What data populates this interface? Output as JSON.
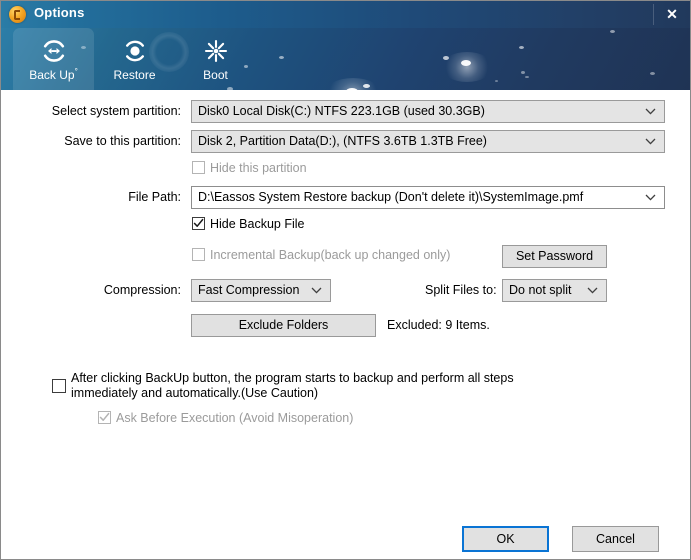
{
  "window": {
    "title": "Options",
    "logo_icon": "eassos-logo-icon",
    "close_icon": "close-icon"
  },
  "toolbar": {
    "tabs": [
      {
        "label": "Back Up",
        "superscript": "°",
        "icon": "backup-arrows-icon",
        "active": true
      },
      {
        "label": "Restore",
        "superscript": "",
        "icon": "restore-icon",
        "active": false
      },
      {
        "label": "Boot",
        "superscript": "",
        "icon": "boot-starburst-icon",
        "active": false
      }
    ]
  },
  "form": {
    "select_system_partition": {
      "label": "Select system partition:",
      "value": "Disk0  Local Disk(C:) NTFS 223.1GB (used 30.3GB)"
    },
    "save_to_partition": {
      "label": "Save to this partition:",
      "value": "Disk 2, Partition Data(D:), (NTFS 3.6TB 1.3TB Free)"
    },
    "hide_this_partition": {
      "label": "Hide this partition",
      "checked": false,
      "disabled": true
    },
    "file_path": {
      "label": "File Path:",
      "value": "D:\\Eassos System Restore backup (Don't delete it)\\SystemImage.pmf"
    },
    "hide_backup_file": {
      "label": "Hide Backup File",
      "checked": true,
      "disabled": false
    },
    "incremental_backup": {
      "label": "Incremental Backup(back up changed only)",
      "checked": false,
      "disabled": true
    },
    "set_password": {
      "label": "Set Password"
    },
    "compression": {
      "label": "Compression:",
      "value": "Fast Compression"
    },
    "split_files": {
      "label": "Split Files to:",
      "value": "Do not split"
    },
    "exclude_folders": {
      "label": "Exclude Folders",
      "status": "Excluded: 9 Items."
    },
    "auto_backup": {
      "label": "After clicking BackUp button, the program starts to backup and perform all steps immediately and automatically.(Use Caution)",
      "checked": false,
      "disabled": false
    },
    "ask_before_execution": {
      "label": "Ask Before Execution (Avoid Misoperation)",
      "checked": true,
      "disabled": true
    }
  },
  "footer": {
    "ok_label": "OK",
    "cancel_label": "Cancel"
  },
  "colors": {
    "title_bar_left": "#2b7ca6",
    "title_bar_right": "#21395c",
    "accent_focus": "#0a74d4",
    "control_face": "#e4e4e4",
    "disabled_text": "#9b9b9b"
  }
}
